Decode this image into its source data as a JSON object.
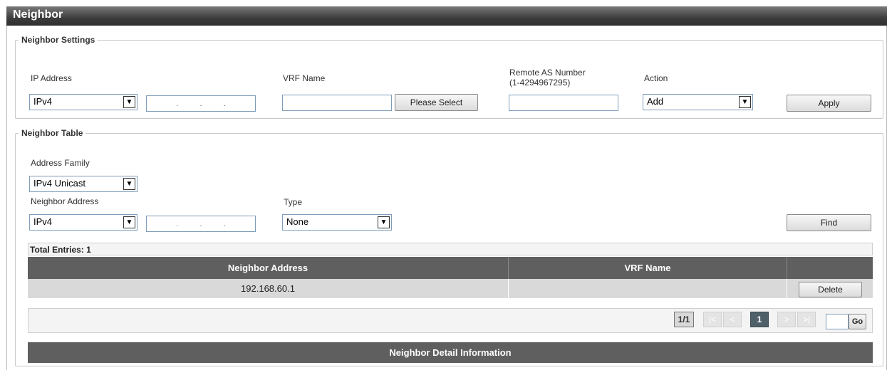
{
  "page": {
    "title": "Neighbor"
  },
  "neighbor_settings": {
    "legend": "Neighbor Settings",
    "ip_address_label": "IP Address",
    "ip_type": "IPv4",
    "vrf_name_label": "VRF Name",
    "vrf_name_value": "",
    "please_select_label": "Please Select",
    "remote_as_label_line1": "Remote AS Number",
    "remote_as_label_line2": "(1-4294967295)",
    "remote_as_value": "",
    "action_label": "Action",
    "action_value": "Add",
    "apply_label": "Apply"
  },
  "neighbor_table": {
    "legend": "Neighbor Table",
    "address_family_label": "Address Family",
    "address_family_value": "IPv4 Unicast",
    "neighbor_address_label": "Neighbor Address",
    "neighbor_address_type": "IPv4",
    "type_label": "Type",
    "type_value": "None",
    "find_label": "Find",
    "total_entries": "Total Entries: 1",
    "columns": [
      "Neighbor Address",
      "VRF Name",
      ""
    ],
    "rows": [
      {
        "neighbor_address": "192.168.60.1",
        "vrf_name": "",
        "action_label": "Delete"
      }
    ],
    "pager": {
      "page_info": "1/1",
      "first": "|<",
      "prev": "<",
      "current": "1",
      "next": ">",
      "last": ">|",
      "go_label": "Go",
      "page_input": ""
    },
    "detail_header": "Neighbor Detail Information"
  }
}
